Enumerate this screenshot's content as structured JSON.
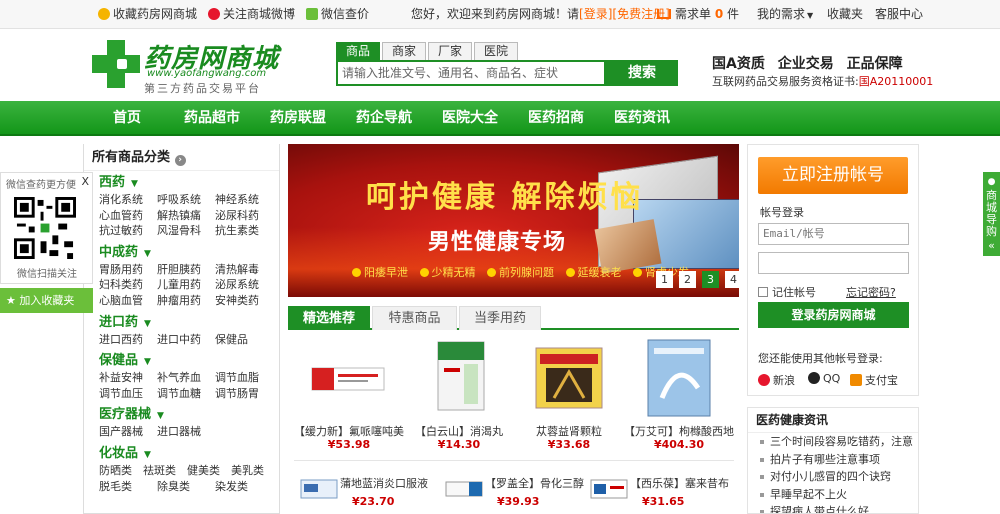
{
  "topbar": {
    "fav_shop": "收藏药房网商城",
    "weibo": "关注商城微博",
    "wechat": "微信查价",
    "welcome": "您好，欢迎来到药房网商城！请",
    "login": "[登录]",
    "register": "[免费注册]",
    "cart_label": "需求单",
    "cart_count": "0",
    "cart_unit": "件",
    "my_needs": "我的需求",
    "favorites": "收藏夹",
    "service": "客服中心"
  },
  "logo": {
    "name": "药房网商城",
    "url": "www.yaofangwang.com",
    "slogan": "第三方药品交易平台"
  },
  "search": {
    "tabs": [
      "商品",
      "商家",
      "厂家",
      "医院"
    ],
    "placeholder": "请输入批准文号、通用名、商品名、症状",
    "button": "搜索"
  },
  "qualification": {
    "line1": "国A资质  企业交易  正品保障",
    "line2": "互联网药品交易服务资格证书:",
    "cert": "国A20110001"
  },
  "nav": [
    "首页",
    "药品超市",
    "药房联盟",
    "药企导航",
    "医院大全",
    "医药招商",
    "医药资讯"
  ],
  "categories": {
    "title": "所有商品分类",
    "groups": [
      {
        "name": "西药",
        "items": [
          [
            "消化系统",
            "呼吸系统",
            "神经系统"
          ],
          [
            "心血管药",
            "解热镇痛",
            "泌尿科药"
          ],
          [
            "抗过敏药",
            "风湿骨科",
            "抗生素类"
          ]
        ]
      },
      {
        "name": "中成药",
        "items": [
          [
            "胃肠用药",
            "肝胆胰药",
            "清热解毒"
          ],
          [
            "妇科类药",
            "儿童用药",
            "泌尿系统"
          ],
          [
            "心脑血管",
            "肿瘤用药",
            "安神类药"
          ]
        ]
      },
      {
        "name": "进口药",
        "items": [
          [
            "进口西药",
            "进口中药",
            "保健品"
          ]
        ]
      },
      {
        "name": "保健品",
        "items": [
          [
            "补益安神",
            "补气养血",
            "调节血脂"
          ],
          [
            "调节血压",
            "调节血糖",
            "调节肠胃"
          ]
        ]
      },
      {
        "name": "医疗器械",
        "items": [
          [
            "国产器械",
            "进口器械"
          ]
        ]
      },
      {
        "name": "化妆品",
        "items": [
          [
            "防晒类",
            "祛斑类",
            "健美类",
            "美乳类"
          ],
          [
            "脱毛类",
            "除臭类",
            "染发类"
          ]
        ]
      }
    ]
  },
  "wechat_box": {
    "title": "微信查药更方便",
    "close": "X",
    "scan": "微信扫描关注"
  },
  "add_fav": "加入收藏夹",
  "banner": {
    "headline": "呵护健康  解除烦恼",
    "subhead": "男性健康专场",
    "features": [
      "阳痿早泄",
      "少精无精",
      "前列腺问题",
      "延缓衰老",
      "肾虚少发"
    ],
    "pages": [
      "1",
      "2",
      "3",
      "4"
    ],
    "active_page": "3"
  },
  "product_tabs": [
    "精选推荐",
    "特惠商品",
    "当季用药"
  ],
  "products": [
    {
      "name": "【缓力新】氟哌噻吨美",
      "price": "¥53.98"
    },
    {
      "name": "【白云山】消渴丸",
      "price": "¥14.30"
    },
    {
      "name": "苁蓉益肾颗粒",
      "price": "¥33.68"
    },
    {
      "name": "【万艾可】枸橼酸西地",
      "price": "¥404.30"
    }
  ],
  "products_row2": [
    {
      "name": "蒲地蓝消炎口服液",
      "price": "¥23.70"
    },
    {
      "name": "【罗盖全】骨化三醇",
      "price": "¥39.93"
    },
    {
      "name": "【西乐葆】塞来昔布",
      "price": "¥31.65"
    }
  ],
  "account": {
    "register_button": "立即注册帐号",
    "login_title": "帐号登录",
    "email_placeholder": "Email/帐号",
    "remember": "记住帐号",
    "forgot": "忘记密码?",
    "login_button": "登录药房网商城",
    "other_login": "您还能使用其他帐号登录:",
    "socials": [
      "新浪",
      "QQ",
      "支付宝"
    ]
  },
  "news": {
    "title": "医药健康资讯",
    "items": [
      "三个时间段容易吃错药，注意",
      "拍片子有哪些注意事项",
      "对付小儿感冒的四个诀窍",
      "早睡早起不上火",
      "探望病人带点什么好"
    ]
  },
  "side_tab": "商城导购",
  "colors": {
    "brand_green": "#1e8f25",
    "accent_orange": "#f27a00",
    "price_red": "#cc0000"
  }
}
